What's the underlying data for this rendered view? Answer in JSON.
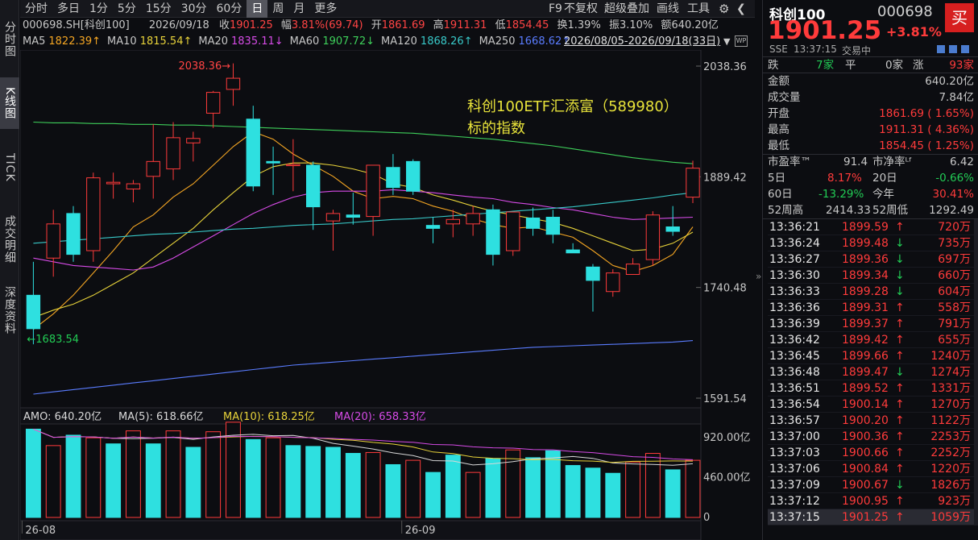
{
  "toolbar": {
    "periods": [
      "分时",
      "多日",
      "1分",
      "5分",
      "15分",
      "30分",
      "60分",
      "日",
      "周",
      "月",
      "更多"
    ],
    "active": "日",
    "right_items": [
      "F9",
      "不复权",
      "超级叠加",
      "画线",
      "工具"
    ]
  },
  "left_tabs": [
    "分时图",
    "K线图",
    "TICK",
    "成交明细",
    "深度资料"
  ],
  "left_tab_active": "K线图",
  "info_line": {
    "code": "000698.SH[科创100]",
    "date": "2026/09/18",
    "close_label": "收",
    "close": "1901.25",
    "range_label": "幅",
    "range": "3.81%(69.74)",
    "open_label": "开",
    "open": "1861.69",
    "high_label": "高",
    "high": "1911.31",
    "low_label": "低",
    "low": "1854.45",
    "turnover_label": "换",
    "turnover": "1.39%",
    "amp_label": "振",
    "amp": "3.10%",
    "amount_label": "额",
    "amount": "640.20亿"
  },
  "ma_line": [
    {
      "label": "MA5",
      "value": "1822.39↑",
      "color": "#f5a623"
    },
    {
      "label": "MA10",
      "value": "1815.54↑",
      "color": "#e8d33a"
    },
    {
      "label": "MA20",
      "value": "1835.11↓",
      "color": "#d64be6"
    },
    {
      "label": "MA60",
      "value": "1907.72↓",
      "color": "#3ecf5a"
    },
    {
      "label": "MA120",
      "value": "1868.26↑",
      "color": "#38c9c9"
    },
    {
      "label": "MA250",
      "value": "1668.62↑",
      "color": "#5a7cff"
    }
  ],
  "date_range": "2026/08/05-2026/09/18(33日)",
  "chart_data": [
    {
      "type": "candlestick",
      "title": "",
      "y_ticks": [
        "2038.36",
        "1889.42",
        "1740.48",
        "1591.54"
      ],
      "ylim": [
        1591.54,
        2038.36
      ],
      "x_labels": [
        "26-08",
        "26-09"
      ],
      "annotation_high": "2038.36",
      "annotation_low": "1683.54",
      "overlay_text": "科创100ETF汇添富（589980）\n标的指数",
      "candles": [
        {
          "o": 1730,
          "h": 1775,
          "l": 1664,
          "c": 1685
        },
        {
          "o": 1780,
          "h": 1845,
          "l": 1755,
          "c": 1826
        },
        {
          "o": 1840,
          "h": 1850,
          "l": 1775,
          "c": 1785
        },
        {
          "o": 1790,
          "h": 1895,
          "l": 1775,
          "c": 1888
        },
        {
          "o": 1880,
          "h": 1895,
          "l": 1860,
          "c": 1882
        },
        {
          "o": 1873,
          "h": 1885,
          "l": 1855,
          "c": 1880
        },
        {
          "o": 1890,
          "h": 1960,
          "l": 1860,
          "c": 1910
        },
        {
          "o": 1900,
          "h": 1963,
          "l": 1885,
          "c": 1942
        },
        {
          "o": 1935,
          "h": 1950,
          "l": 1910,
          "c": 1941
        },
        {
          "o": 1975,
          "h": 2005,
          "l": 1955,
          "c": 2003
        },
        {
          "o": 2007,
          "h": 2042,
          "l": 1985,
          "c": 2022
        },
        {
          "o": 1967,
          "h": 1985,
          "l": 1870,
          "c": 1877
        },
        {
          "o": 1910,
          "h": 1930,
          "l": 1865,
          "c": 1908
        },
        {
          "o": 1906,
          "h": 1940,
          "l": 1870,
          "c": 1906
        },
        {
          "o": 1905,
          "h": 1910,
          "l": 1818,
          "c": 1849
        },
        {
          "o": 1830,
          "h": 1845,
          "l": 1790,
          "c": 1840
        },
        {
          "o": 1838,
          "h": 1868,
          "l": 1825,
          "c": 1835
        },
        {
          "o": 1836,
          "h": 1905,
          "l": 1810,
          "c": 1905
        },
        {
          "o": 1902,
          "h": 1920,
          "l": 1865,
          "c": 1875
        },
        {
          "o": 1910,
          "h": 1913,
          "l": 1865,
          "c": 1870
        },
        {
          "o": 1824,
          "h": 1835,
          "l": 1800,
          "c": 1820
        },
        {
          "o": 1826,
          "h": 1845,
          "l": 1808,
          "c": 1832
        },
        {
          "o": 1826,
          "h": 1850,
          "l": 1810,
          "c": 1840
        },
        {
          "o": 1845,
          "h": 1852,
          "l": 1770,
          "c": 1785
        },
        {
          "o": 1790,
          "h": 1835,
          "l": 1783,
          "c": 1842
        },
        {
          "o": 1834,
          "h": 1848,
          "l": 1810,
          "c": 1820
        },
        {
          "o": 1835,
          "h": 1845,
          "l": 1800,
          "c": 1812
        },
        {
          "o": 1791,
          "h": 1800,
          "l": 1787,
          "c": 1787
        },
        {
          "o": 1768,
          "h": 1772,
          "l": 1708,
          "c": 1750
        },
        {
          "o": 1735,
          "h": 1765,
          "l": 1728,
          "c": 1760
        },
        {
          "o": 1758,
          "h": 1780,
          "l": 1758,
          "c": 1772
        },
        {
          "o": 1778,
          "h": 1843,
          "l": 1770,
          "c": 1838
        },
        {
          "o": 1822,
          "h": 1850,
          "l": 1810,
          "c": 1816
        },
        {
          "o": 1862,
          "h": 1911,
          "l": 1854,
          "c": 1901
        }
      ],
      "ma_series": [
        {
          "name": "MA5",
          "color": "#f5a623",
          "values": [
            1684,
            1705,
            1730,
            1760,
            1790,
            1822,
            1838,
            1862,
            1880,
            1905,
            1930,
            1950,
            1940,
            1920,
            1905,
            1890,
            1870,
            1860,
            1863,
            1860,
            1850,
            1843,
            1833,
            1825,
            1820,
            1822,
            1815,
            1808,
            1790,
            1770,
            1762,
            1770,
            1785,
            1822
          ]
        },
        {
          "name": "MA10",
          "color": "#e8d33a",
          "values": [
            1700,
            1710,
            1718,
            1730,
            1745,
            1760,
            1780,
            1800,
            1820,
            1845,
            1868,
            1890,
            1903,
            1908,
            1908,
            1905,
            1900,
            1893,
            1880,
            1875,
            1865,
            1858,
            1850,
            1843,
            1838,
            1833,
            1828,
            1820,
            1810,
            1800,
            1790,
            1792,
            1800,
            1815
          ]
        },
        {
          "name": "MA20",
          "color": "#d64be6",
          "values": [
            1780,
            1775,
            1770,
            1768,
            1766,
            1764,
            1768,
            1780,
            1795,
            1810,
            1825,
            1840,
            1852,
            1862,
            1868,
            1870,
            1870,
            1870,
            1872,
            1870,
            1868,
            1865,
            1862,
            1860,
            1855,
            1852,
            1848,
            1845,
            1840,
            1835,
            1832,
            1833,
            1834,
            1835
          ]
        },
        {
          "name": "MA60",
          "color": "#3ecf5a",
          "values": [
            1963,
            1962,
            1962,
            1961,
            1961,
            1960,
            1960,
            1959,
            1959,
            1958,
            1957,
            1956,
            1955,
            1954,
            1953,
            1952,
            1951,
            1950,
            1949,
            1948,
            1946,
            1944,
            1942,
            1940,
            1937,
            1934,
            1931,
            1927,
            1923,
            1919,
            1915,
            1912,
            1909,
            1907
          ]
        },
        {
          "name": "MA120",
          "color": "#38c9c9",
          "values": [
            1800,
            1802,
            1804,
            1806,
            1808,
            1810,
            1812,
            1813,
            1815,
            1817,
            1819,
            1820,
            1822,
            1824,
            1825,
            1826,
            1828,
            1830,
            1832,
            1833,
            1835,
            1837,
            1839,
            1841,
            1843,
            1845,
            1847,
            1849,
            1852,
            1855,
            1858,
            1861,
            1865,
            1868
          ]
        },
        {
          "name": "MA250",
          "color": "#5a7cff",
          "values": [
            1597,
            1600,
            1603,
            1606,
            1609,
            1612,
            1615,
            1618,
            1621,
            1624,
            1627,
            1630,
            1633,
            1636,
            1638,
            1640,
            1642,
            1644,
            1646,
            1648,
            1650,
            1652,
            1654,
            1656,
            1658,
            1660,
            1661,
            1662,
            1663,
            1664,
            1665,
            1666,
            1667,
            1669
          ]
        }
      ]
    },
    {
      "type": "bar",
      "title": "",
      "legend": [
        {
          "label": "AMO: 640.20亿",
          "color": "#d8d8d8"
        },
        {
          "label": "MA(5): 618.66亿",
          "color": "#d8d8d8"
        },
        {
          "label": "MA(10): 618.25亿",
          "color": "#e8d33a"
        },
        {
          "label": "MA(20): 658.33亿",
          "color": "#d64be6"
        }
      ],
      "y_ticks": [
        "920.00亿",
        "460.00亿",
        "0"
      ],
      "ylim": [
        0,
        1080
      ],
      "values": [
        1020,
        830,
        950,
        920,
        850,
        1000,
        850,
        1000,
        810,
        990,
        1100,
        900,
        920,
        830,
        820,
        810,
        740,
        750,
        610,
        660,
        520,
        720,
        520,
        680,
        780,
        690,
        770,
        600,
        570,
        510,
        640,
        740,
        550,
        660
      ],
      "up": [
        false,
        true,
        false,
        true,
        false,
        true,
        false,
        true,
        false,
        true,
        true,
        false,
        true,
        false,
        false,
        false,
        false,
        true,
        false,
        true,
        false,
        false,
        true,
        false,
        true,
        false,
        false,
        false,
        false,
        false,
        true,
        true,
        false,
        true
      ]
    }
  ],
  "quote": {
    "name": "科创100",
    "code": "000698",
    "price": "1901.25",
    "change_pct": "+3.81%",
    "buy_label": "买",
    "exchange": "SSE",
    "time": "13:37:15",
    "status": "交易中",
    "fall_label": "跌",
    "fall": "7家",
    "flat_label": "平",
    "flat": "0家",
    "rise_label": "涨",
    "rise": "93家",
    "rows": [
      {
        "label": "金额",
        "value": "640.20亿"
      },
      {
        "label": "成交量",
        "value": "7.84亿"
      },
      {
        "label": "开盘",
        "value": "1861.69 ( 1.65%)"
      },
      {
        "label": "最高",
        "value": "1911.31 ( 4.36%)"
      },
      {
        "label": "最低",
        "value": "1854.45 ( 1.25%)"
      }
    ],
    "pe_label": "市盈率™",
    "pe": "91.4",
    "pb_label": "市净率ᴸᶠ",
    "pb": "6.42",
    "d5_label": "5日",
    "d5": "8.17%",
    "d20_label": "20日",
    "d20": "-0.66%",
    "d60_label": "60日",
    "d60": "-13.29%",
    "ytd_label": "今年",
    "ytd": "30.41%",
    "w52h_label": "52周高",
    "w52h": "2414.33",
    "w52l_label": "52周低",
    "w52l": "1292.49"
  },
  "ticks": [
    {
      "t": "13:36:21",
      "p": "1899.59",
      "a": "up",
      "v": "720万"
    },
    {
      "t": "13:36:24",
      "p": "1899.48",
      "a": "down",
      "v": "735万"
    },
    {
      "t": "13:36:27",
      "p": "1899.36",
      "a": "down",
      "v": "697万"
    },
    {
      "t": "13:36:30",
      "p": "1899.34",
      "a": "down",
      "v": "660万"
    },
    {
      "t": "13:36:33",
      "p": "1899.28",
      "a": "down",
      "v": "604万"
    },
    {
      "t": "13:36:36",
      "p": "1899.31",
      "a": "up",
      "v": "558万"
    },
    {
      "t": "13:36:39",
      "p": "1899.37",
      "a": "up",
      "v": "791万"
    },
    {
      "t": "13:36:42",
      "p": "1899.42",
      "a": "up",
      "v": "655万"
    },
    {
      "t": "13:36:45",
      "p": "1899.66",
      "a": "up",
      "v": "1240万"
    },
    {
      "t": "13:36:48",
      "p": "1899.47",
      "a": "down",
      "v": "1274万"
    },
    {
      "t": "13:36:51",
      "p": "1899.52",
      "a": "up",
      "v": "1331万"
    },
    {
      "t": "13:36:54",
      "p": "1900.14",
      "a": "up",
      "v": "1270万"
    },
    {
      "t": "13:36:57",
      "p": "1900.20",
      "a": "up",
      "v": "1122万"
    },
    {
      "t": "13:37:00",
      "p": "1900.36",
      "a": "up",
      "v": "2253万"
    },
    {
      "t": "13:37:03",
      "p": "1900.66",
      "a": "up",
      "v": "2252万"
    },
    {
      "t": "13:37:06",
      "p": "1900.84",
      "a": "up",
      "v": "1220万"
    },
    {
      "t": "13:37:09",
      "p": "1900.67",
      "a": "down",
      "v": "1826万"
    },
    {
      "t": "13:37:12",
      "p": "1900.95",
      "a": "up",
      "v": "923万"
    },
    {
      "t": "13:37:15",
      "p": "1901.25",
      "a": "up",
      "v": "1059万"
    }
  ],
  "colors": {
    "up": "#ff3b3b",
    "down": "#2ee0e0",
    "down_arrow": "#22cc55",
    "bg": "#0c0d11"
  }
}
